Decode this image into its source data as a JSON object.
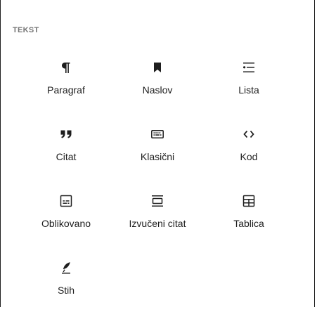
{
  "category": {
    "title": "TEKST"
  },
  "blocks": [
    {
      "label": "Paragraf",
      "icon": "paragraph-icon"
    },
    {
      "label": "Naslov",
      "icon": "bookmark-icon"
    },
    {
      "label": "Lista",
      "icon": "list-icon"
    },
    {
      "label": "Citat",
      "icon": "quote-icon"
    },
    {
      "label": "Klasični",
      "icon": "keyboard-icon"
    },
    {
      "label": "Kod",
      "icon": "code-icon"
    },
    {
      "label": "Oblikovano",
      "icon": "preformatted-icon"
    },
    {
      "label": "Izvučeni citat",
      "icon": "pullquote-icon"
    },
    {
      "label": "Tablica",
      "icon": "table-icon"
    },
    {
      "label": "Stih",
      "icon": "verse-icon"
    }
  ],
  "colors": {
    "text": "#1e1e1e",
    "category_title": "#757575",
    "background": "#ffffff"
  }
}
